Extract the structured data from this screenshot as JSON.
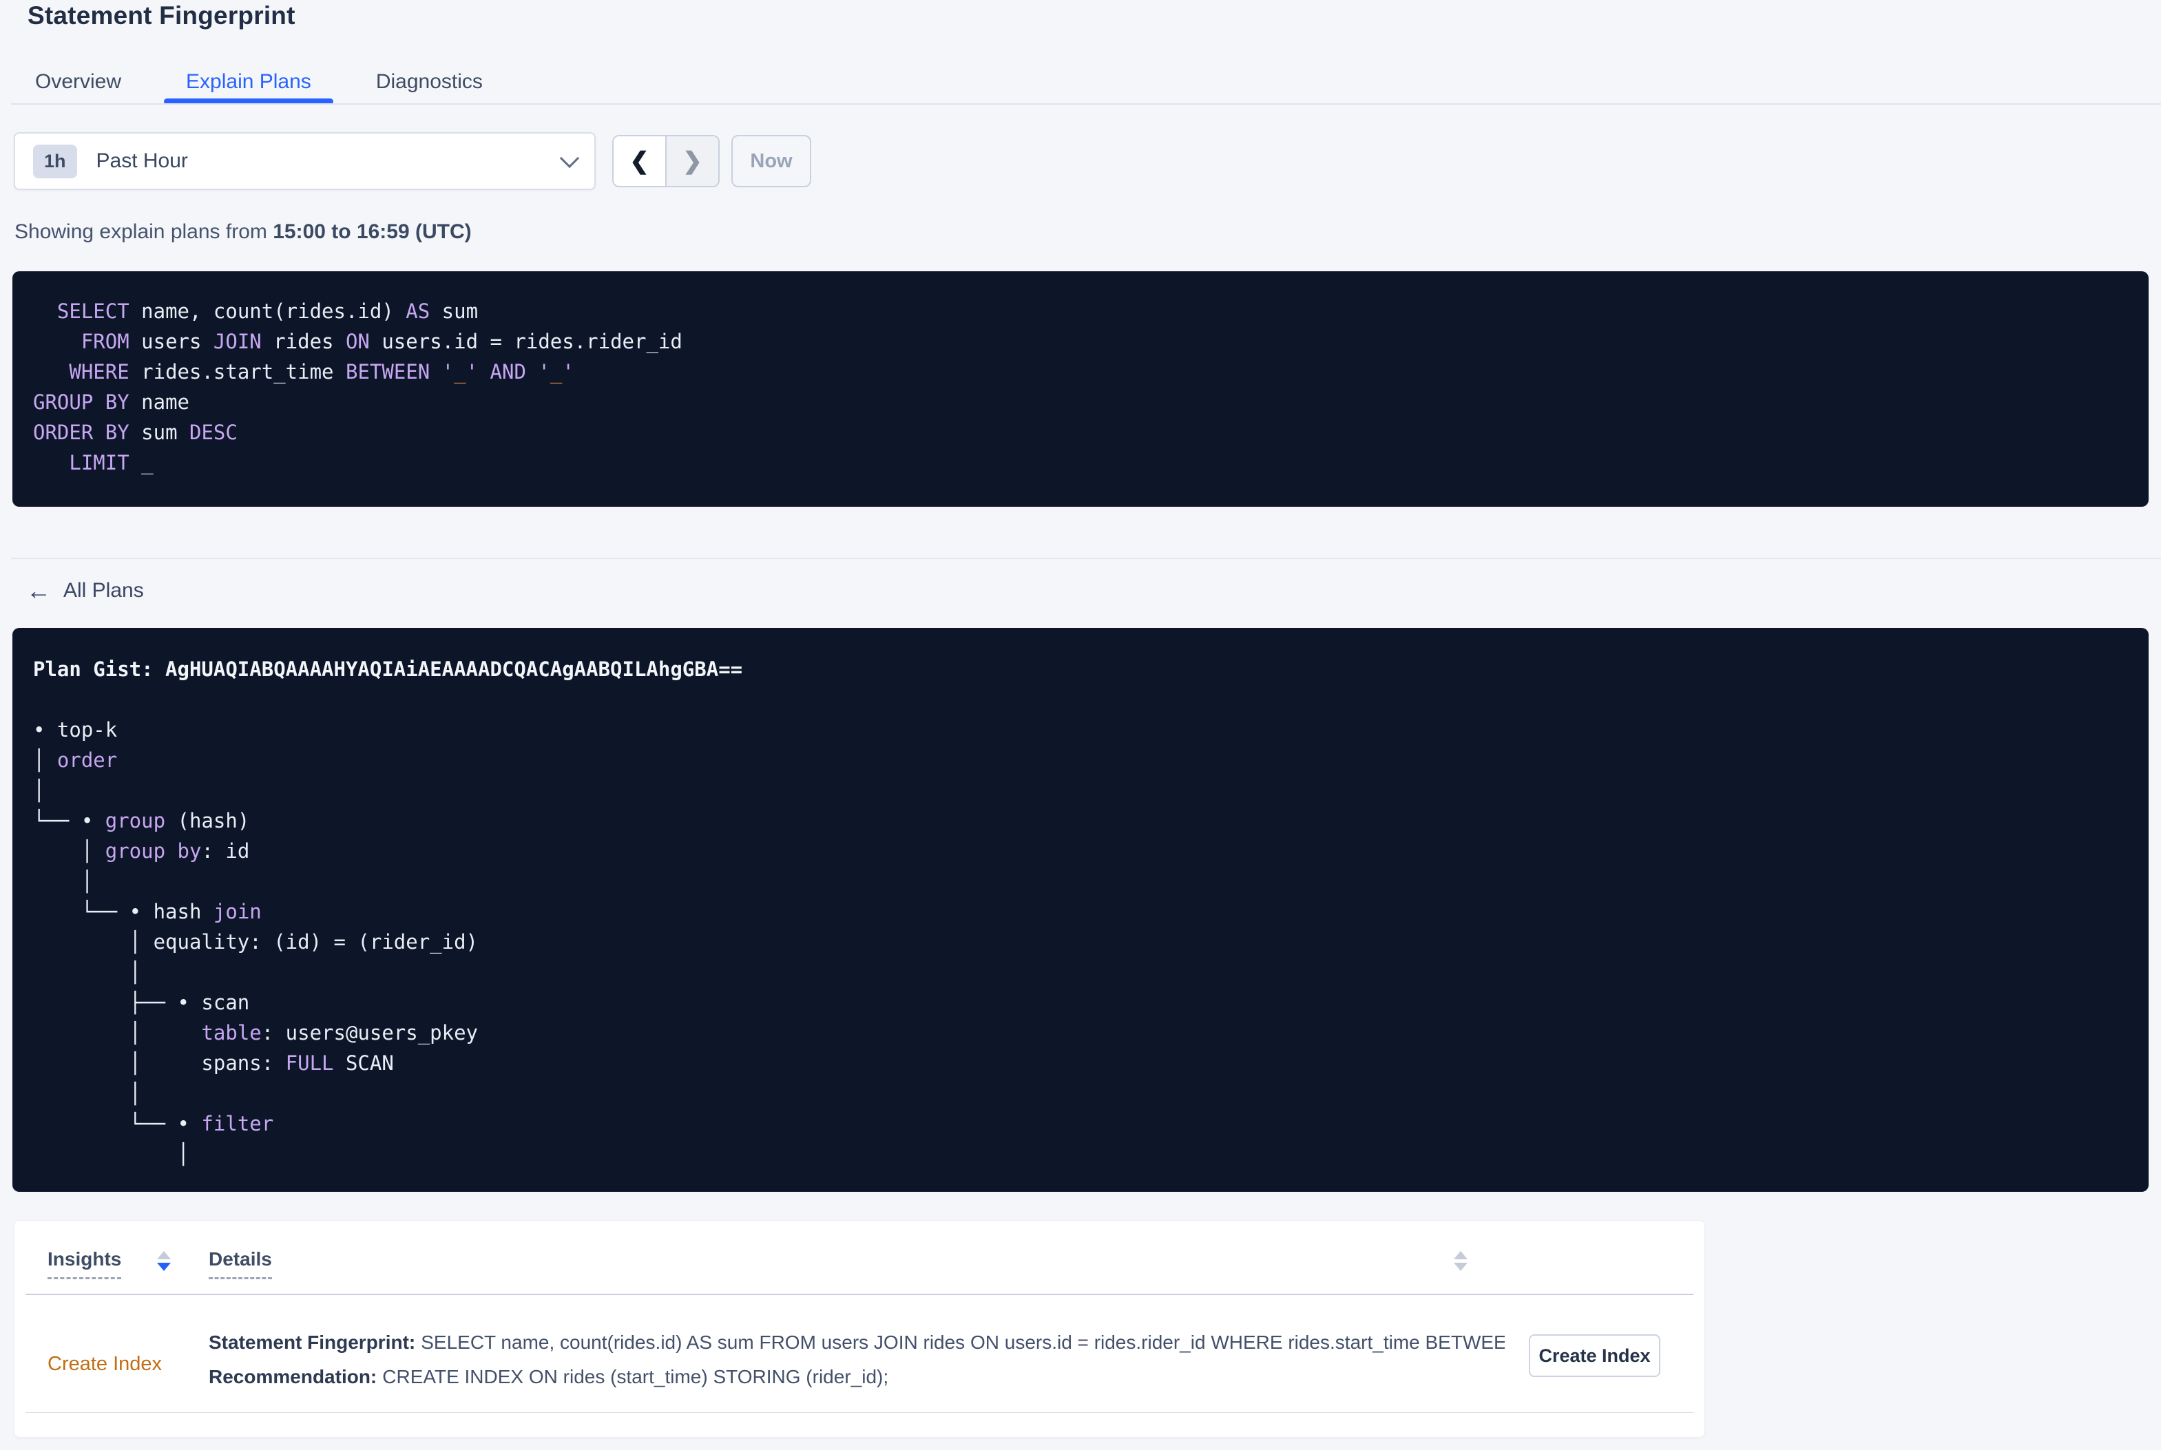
{
  "page": {
    "title": "Statement Fingerprint"
  },
  "tabs": [
    {
      "label": "Overview",
      "active": false
    },
    {
      "label": "Explain Plans",
      "active": true
    },
    {
      "label": "Diagnostics",
      "active": false
    }
  ],
  "time_picker": {
    "interval_badge": "1h",
    "selected_label": "Past Hour",
    "prev_icon": "❮",
    "next_icon": "❯",
    "now_label": "Now"
  },
  "status_line": {
    "prefix": "Showing explain plans from ",
    "range_bold": "15:00 to 16:59 (UTC)"
  },
  "sql_block": {
    "lines": [
      [
        [
          "p",
          "  "
        ],
        [
          "k",
          "SELECT"
        ],
        [
          "p",
          " name, count(rides.id) "
        ],
        [
          "k",
          "AS"
        ],
        [
          "p",
          " sum"
        ]
      ],
      [
        [
          "p",
          "    "
        ],
        [
          "k",
          "FROM"
        ],
        [
          "p",
          " users "
        ],
        [
          "k",
          "JOIN"
        ],
        [
          "p",
          " rides "
        ],
        [
          "k",
          "ON"
        ],
        [
          "p",
          " users.id = rides.rider_id"
        ]
      ],
      [
        [
          "p",
          "   "
        ],
        [
          "k",
          "WHERE"
        ],
        [
          "p",
          " rides.start_time "
        ],
        [
          "k",
          "BETWEEN"
        ],
        [
          "p",
          " "
        ],
        [
          "k",
          "'"
        ],
        [
          "o",
          "_"
        ],
        [
          "k",
          "'"
        ],
        [
          "p",
          " "
        ],
        [
          "k",
          "AND"
        ],
        [
          "p",
          " "
        ],
        [
          "k",
          "'"
        ],
        [
          "o",
          "_"
        ],
        [
          "k",
          "'"
        ]
      ],
      [
        [
          "k",
          "GROUP BY"
        ],
        [
          "p",
          " name"
        ]
      ],
      [
        [
          "k",
          "ORDER BY"
        ],
        [
          "p",
          " sum "
        ],
        [
          "k",
          "DESC"
        ]
      ],
      [
        [
          "p",
          "   "
        ],
        [
          "k",
          "LIMIT"
        ],
        [
          "p",
          " _"
        ]
      ]
    ]
  },
  "back_link": {
    "arrow": "←",
    "label": "All Plans"
  },
  "plan_block": {
    "lines": [
      [
        [
          "b",
          "Plan Gist: AgHUAQIABQAAAAHYAQIAiAEAAAADCQACAgAABQILAhgGBA=="
        ]
      ],
      [
        [
          "p",
          ""
        ]
      ],
      [
        [
          "p",
          "• top-k"
        ]
      ],
      [
        [
          "p",
          "│ "
        ],
        [
          "k",
          "order"
        ]
      ],
      [
        [
          "p",
          "│"
        ]
      ],
      [
        [
          "p",
          "└── • "
        ],
        [
          "k",
          "group"
        ],
        [
          "p",
          " (hash)"
        ]
      ],
      [
        [
          "p",
          "    │ "
        ],
        [
          "k",
          "group by"
        ],
        [
          "p",
          ": id"
        ]
      ],
      [
        [
          "p",
          "    │"
        ]
      ],
      [
        [
          "p",
          "    └── • hash "
        ],
        [
          "k",
          "join"
        ]
      ],
      [
        [
          "p",
          "        │ equality: (id) = (rider_id)"
        ]
      ],
      [
        [
          "p",
          "        │"
        ]
      ],
      [
        [
          "p",
          "        ├── • scan"
        ]
      ],
      [
        [
          "p",
          "        │     "
        ],
        [
          "k",
          "table"
        ],
        [
          "p",
          ": users@users_pkey"
        ]
      ],
      [
        [
          "p",
          "        │     spans: "
        ],
        [
          "k",
          "FULL"
        ],
        [
          "p",
          " SCAN"
        ]
      ],
      [
        [
          "p",
          "        │"
        ]
      ],
      [
        [
          "p",
          "        └── • "
        ],
        [
          "k",
          "filter"
        ]
      ],
      [
        [
          "p",
          "            │"
        ]
      ]
    ]
  },
  "insights_table": {
    "columns": [
      {
        "label": "Insights",
        "sort": "desc"
      },
      {
        "label": "Details",
        "sort": "none"
      }
    ],
    "rows": [
      {
        "insight": "Create Index",
        "details": [
          {
            "label": "Statement Fingerprint:",
            "text": "SELECT name, count(rides.id) AS sum FROM users JOIN rides ON users.id = rides.rider_id WHERE rides.start_time BETWEEN '_…"
          },
          {
            "label": "Recommendation:",
            "text": "CREATE INDEX ON rides (start_time) STORING (rider_id);"
          }
        ],
        "action_label": "Create Index"
      }
    ]
  },
  "colors": {
    "accent_blue": "#2963ff",
    "insight_orange": "#c06e12",
    "code_background": "#0d1628",
    "code_keyword_purple": "#c7a6f2",
    "code_literal_orange": "#e8913f",
    "page_background": "#f4f6fa"
  }
}
